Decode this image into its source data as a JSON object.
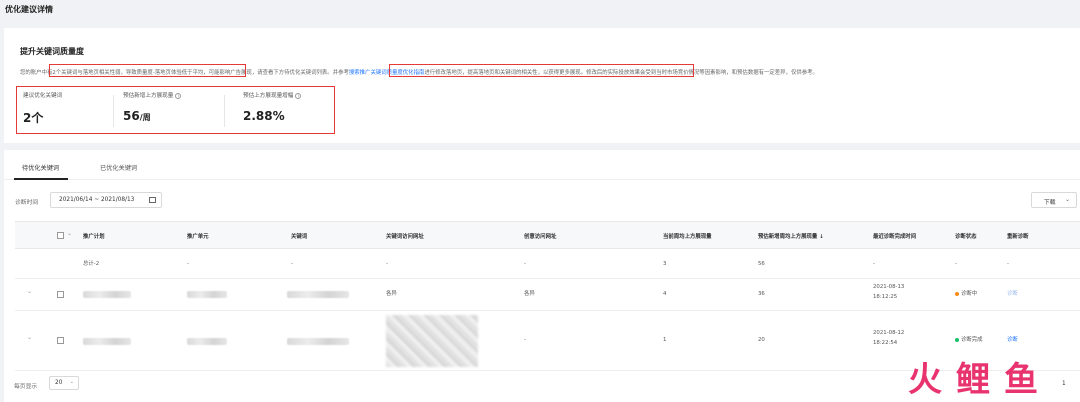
{
  "page": {
    "title": "优化建议详情"
  },
  "summary": {
    "title": "提升关键词质量度",
    "desc_part1": "您的账户中有",
    "desc_highlight1": "2个关键词与落地页相关性弱，导致质量度-落地页体验低于平均",
    "desc_part2": "，可能影响广告展现，请查看下方待优化关键词列表。",
    "desc_highlight2": "并参考搜索推广关键词质量度优化指南进行修改落地页，提高落地页和关键词的相关性，以获得更多展现。",
    "desc_link": "搜索推广关键词质量度优化指南",
    "desc_part3": "修改后的实际投放效果会受到当时市场竞价情况等因素影响，和预估数据有一定差异，仅供参考。",
    "metrics": [
      {
        "label": "建议优化关键词",
        "value": "2个",
        "unit": ""
      },
      {
        "label": "预估新增上方展现量",
        "value": "56",
        "unit": "/周"
      },
      {
        "label": "预估上方展现量增幅",
        "value": "2.88%",
        "unit": ""
      }
    ]
  },
  "tabs": [
    {
      "label": "待优化关键词"
    },
    {
      "label": "已优化关键词"
    }
  ],
  "filter": {
    "date_label": "诊断时间",
    "date_range": "2021/06/14 ~ 2021/08/13",
    "download_label": "下载"
  },
  "table": {
    "headers": [
      "推广计划",
      "推广单元",
      "关键词",
      "关键词访问网址",
      "创意访问网址",
      "当前周均上方展现量",
      "预估新增周均上方展现量",
      "最近诊断完成时间",
      "诊断状态",
      "重新诊断"
    ],
    "sort_icon": "arrow-down",
    "total_row": [
      "总计-2",
      "-",
      "-",
      "-",
      "-",
      "3",
      "56",
      "-",
      "-",
      "-"
    ],
    "rows": [
      {
        "keyword_url": "各异",
        "creative_url": "各异",
        "current": "4",
        "estimated": "36",
        "date": "2021-08-13",
        "time": "18:12:25",
        "status": "诊断中",
        "status_color": "#fa8c16",
        "action": "诊断"
      },
      {
        "keyword_url": "",
        "creative_url": "-",
        "current": "1",
        "estimated": "20",
        "date": "2021-08-12",
        "time": "18:22:54",
        "status": "诊断完成",
        "status_color": "#19be6b",
        "action": "诊断"
      }
    ]
  },
  "footer": {
    "page_size_label": "每页显示",
    "page_size": "20",
    "current_page": "1"
  },
  "watermark": {
    "chars": [
      "火",
      "鲤",
      "鱼"
    ]
  }
}
